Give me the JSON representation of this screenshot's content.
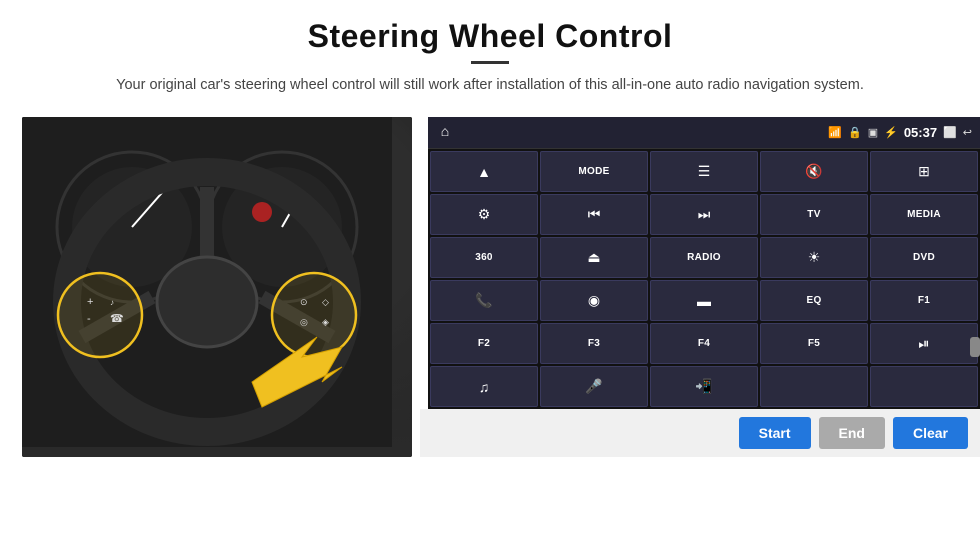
{
  "header": {
    "title": "Steering Wheel Control",
    "subtitle": "Your original car's steering wheel control will still work after installation of this all-in-one auto radio navigation system."
  },
  "status_bar": {
    "time": "05:37",
    "icons": [
      "wifi",
      "lock",
      "sim",
      "bluetooth",
      "screen",
      "back"
    ]
  },
  "grid_buttons": [
    {
      "id": "r1c1",
      "type": "icon",
      "icon": "▲",
      "label": "navigate-icon"
    },
    {
      "id": "r1c2",
      "type": "text",
      "text": "MODE"
    },
    {
      "id": "r1c3",
      "type": "icon",
      "icon": "≡",
      "label": "list-icon"
    },
    {
      "id": "r1c4",
      "type": "icon",
      "icon": "🔇",
      "label": "mute-icon"
    },
    {
      "id": "r1c5",
      "type": "icon",
      "icon": "⊞",
      "label": "apps-icon"
    },
    {
      "id": "r2c1",
      "type": "icon",
      "icon": "◎",
      "label": "settings-icon"
    },
    {
      "id": "r2c2",
      "type": "icon",
      "icon": "⏮",
      "label": "prev-icon"
    },
    {
      "id": "r2c3",
      "type": "icon",
      "icon": "⏭",
      "label": "next-icon"
    },
    {
      "id": "r2c4",
      "type": "text",
      "text": "TV"
    },
    {
      "id": "r2c5",
      "type": "text",
      "text": "MEDIA"
    },
    {
      "id": "r3c1",
      "type": "text",
      "text": "360"
    },
    {
      "id": "r3c2",
      "type": "icon",
      "icon": "⏏",
      "label": "eject-icon"
    },
    {
      "id": "r3c3",
      "type": "text",
      "text": "RADIO"
    },
    {
      "id": "r3c4",
      "type": "icon",
      "icon": "☀",
      "label": "brightness-icon"
    },
    {
      "id": "r3c5",
      "type": "text",
      "text": "DVD"
    },
    {
      "id": "r4c1",
      "type": "icon",
      "icon": "📞",
      "label": "phone-icon"
    },
    {
      "id": "r4c2",
      "type": "icon",
      "icon": "◉",
      "label": "map-icon"
    },
    {
      "id": "r4c3",
      "type": "icon",
      "icon": "▬",
      "label": "screen-icon"
    },
    {
      "id": "r4c4",
      "type": "text",
      "text": "EQ"
    },
    {
      "id": "r4c5",
      "type": "text",
      "text": "F1"
    },
    {
      "id": "r5c1",
      "type": "text",
      "text": "F2"
    },
    {
      "id": "r5c2",
      "type": "text",
      "text": "F3"
    },
    {
      "id": "r5c3",
      "type": "text",
      "text": "F4"
    },
    {
      "id": "r5c4",
      "type": "text",
      "text": "F5"
    },
    {
      "id": "r5c5",
      "type": "icon",
      "icon": "⏯",
      "label": "playpause-icon"
    },
    {
      "id": "r6c1",
      "type": "icon",
      "icon": "♫",
      "label": "music-icon"
    },
    {
      "id": "r6c2",
      "type": "icon",
      "icon": "🎤",
      "label": "mic-icon"
    },
    {
      "id": "r6c3",
      "type": "icon",
      "icon": "📞↙",
      "label": "answer-icon"
    },
    {
      "id": "r6c4",
      "type": "empty",
      "text": ""
    },
    {
      "id": "r6c5",
      "type": "empty",
      "text": ""
    }
  ],
  "bottom_bar": {
    "start_label": "Start",
    "end_label": "End",
    "clear_label": "Clear"
  },
  "colors": {
    "accent_blue": "#2277dd",
    "panel_bg": "#1a1a2e",
    "btn_bg": "#2a2a3e",
    "btn_border": "#3a3a5e"
  }
}
